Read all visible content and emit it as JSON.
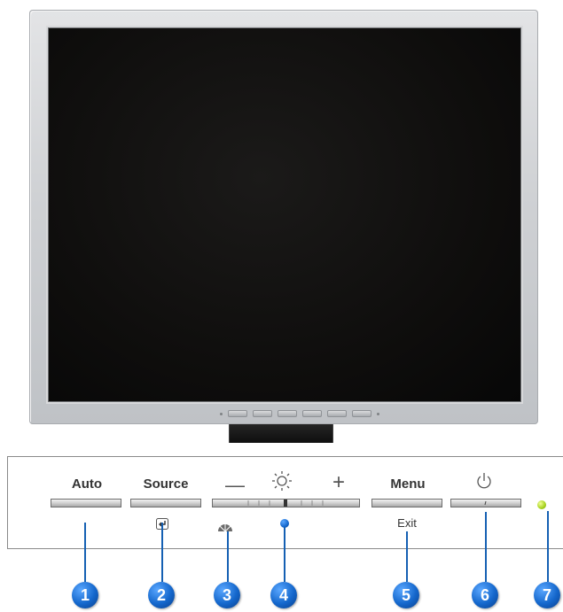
{
  "controls": {
    "auto": {
      "label": "Auto"
    },
    "source": {
      "label": "Source",
      "icon": "enter-icon"
    },
    "adjust": {
      "minus": "—",
      "plus": "+",
      "icon": "brightness-icon",
      "sub_icon": "magicbright-icon"
    },
    "menu": {
      "label": "Menu",
      "sub": "Exit"
    },
    "power": {
      "icon": "power-icon"
    },
    "indicator": {
      "icon": "power-led"
    }
  },
  "callouts": [
    "1",
    "2",
    "3",
    "4",
    "5",
    "6",
    "7"
  ],
  "colors": {
    "callout": "#1560b3",
    "led": "#a6d21c",
    "bezel": "#cfd1d4",
    "screen": "#0f0e0d"
  }
}
